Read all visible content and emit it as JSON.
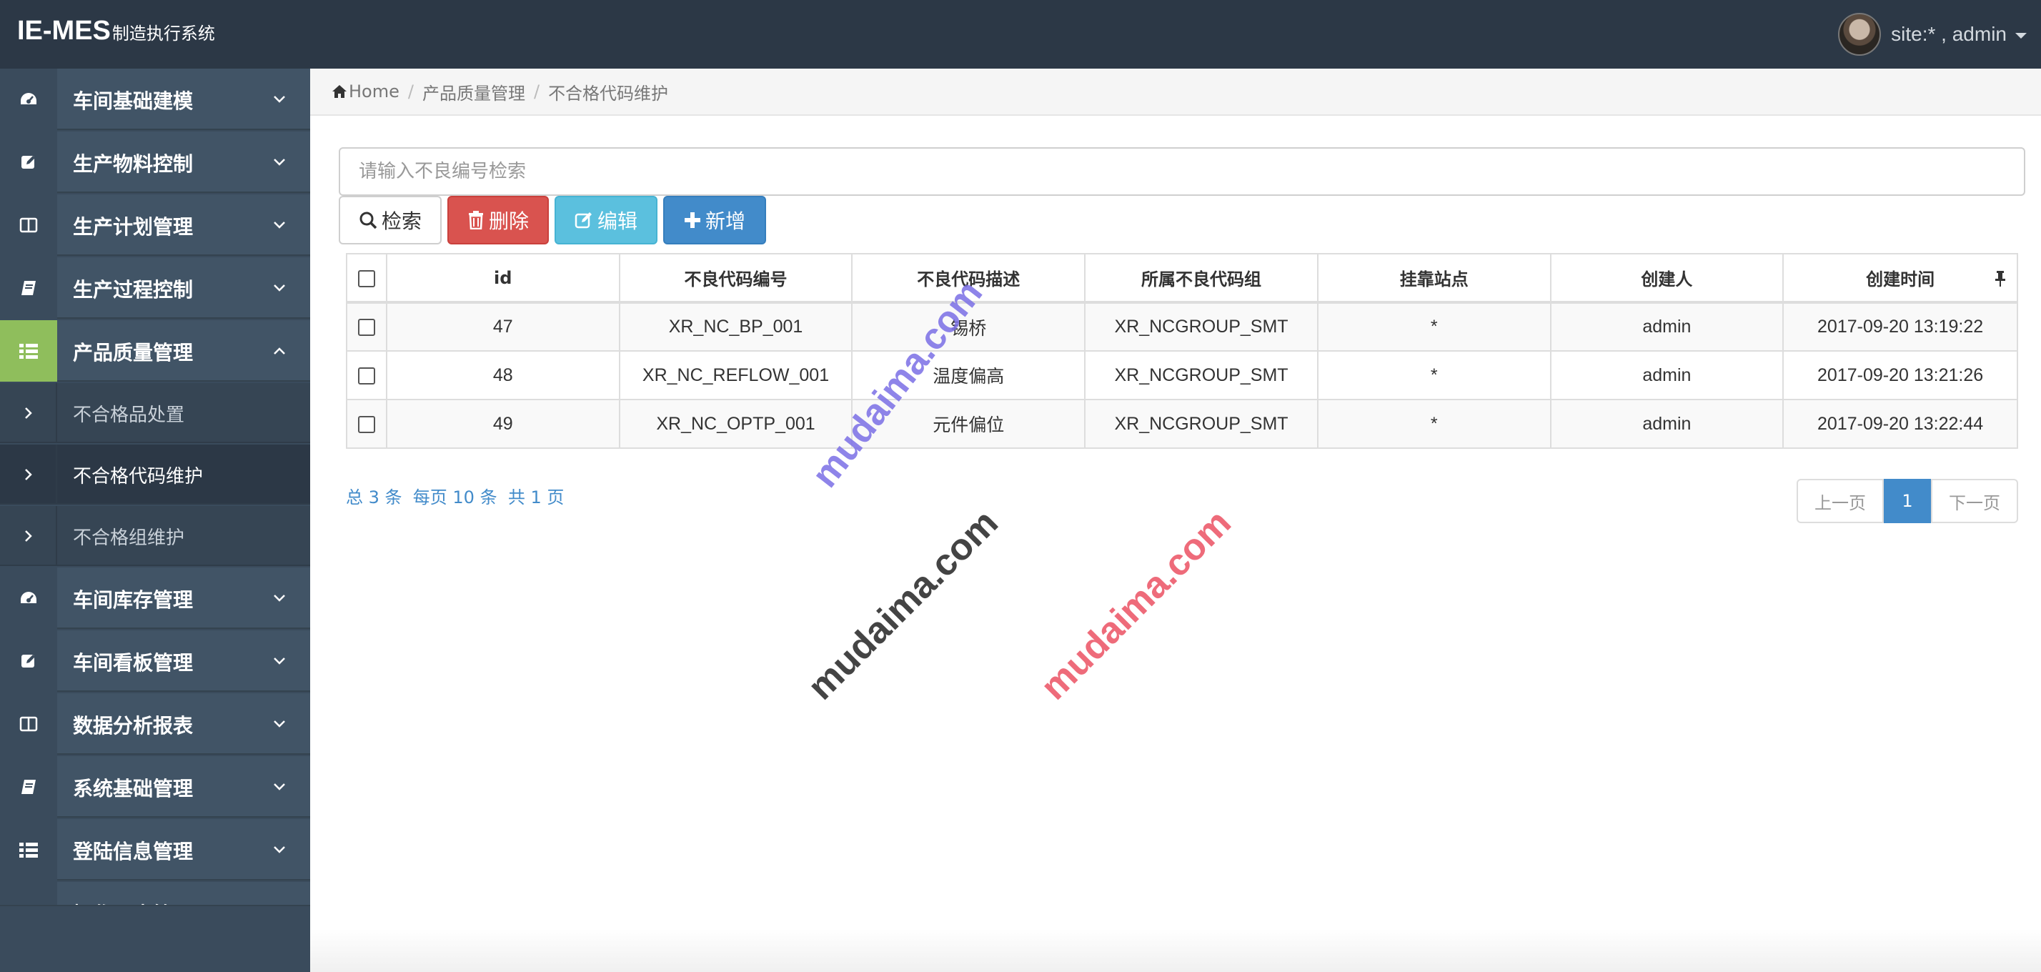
{
  "app": {
    "brand_main": "IE-MES",
    "brand_sub": "制造执行系统"
  },
  "user": {
    "label": "site:* , admin"
  },
  "sidebar": {
    "items": [
      {
        "label": "车间基础建模",
        "icon": "dashboard-icon"
      },
      {
        "label": "生产物料控制",
        "icon": "edit-icon"
      },
      {
        "label": "生产计划管理",
        "icon": "columns-icon"
      },
      {
        "label": "生产过程控制",
        "icon": "book-icon"
      },
      {
        "label": "产品质量管理",
        "icon": "list-icon",
        "active": true
      },
      {
        "label": "车间库存管理",
        "icon": "dashboard-icon"
      },
      {
        "label": "车间看板管理",
        "icon": "edit-icon"
      },
      {
        "label": "数据分析报表",
        "icon": "columns-icon"
      },
      {
        "label": "系统基础管理",
        "icon": "book-icon"
      },
      {
        "label": "登陆信息管理",
        "icon": "list-icon"
      },
      {
        "label": "操作日志管理",
        "icon": "dashboard-icon"
      }
    ],
    "subitems": [
      {
        "label": "不合格品处置"
      },
      {
        "label": "不合格代码维护",
        "active": true
      },
      {
        "label": "不合格组维护"
      }
    ]
  },
  "breadcrumb": {
    "home": "Home",
    "level1": "产品质量管理",
    "level2": "不合格代码维护"
  },
  "search": {
    "placeholder": "请输入不良编号检索"
  },
  "toolbar": {
    "search_label": "检索",
    "delete_label": "删除",
    "edit_label": "编辑",
    "add_label": "新增"
  },
  "table": {
    "headers": [
      "id",
      "不良代码编号",
      "不良代码描述",
      "所属不良代码组",
      "挂靠站点",
      "创建人",
      "创建时间"
    ],
    "rows": [
      [
        "47",
        "XR_NC_BP_001",
        "锡桥",
        "XR_NCGROUP_SMT",
        "*",
        "admin",
        "2017-09-20 13:19:22"
      ],
      [
        "48",
        "XR_NC_REFLOW_001",
        "温度偏高",
        "XR_NCGROUP_SMT",
        "*",
        "admin",
        "2017-09-20 13:21:26"
      ],
      [
        "49",
        "XR_NC_OPTP_001",
        "元件偏位",
        "XR_NCGROUP_SMT",
        "*",
        "admin",
        "2017-09-20 13:22:44"
      ]
    ]
  },
  "pagination": {
    "info": "总 3 条  每页 10 条  共 1 页",
    "prev": "上一页",
    "current": "1",
    "next": "下一页"
  },
  "watermark": {
    "text": "mudaima.com"
  },
  "colors": {
    "topbar": "#2c3846",
    "sidebar": "#3a4b5c",
    "active_icon": "#8fbe5c",
    "primary": "#428bca",
    "danger": "#d9534f",
    "info": "#5bc0de"
  }
}
